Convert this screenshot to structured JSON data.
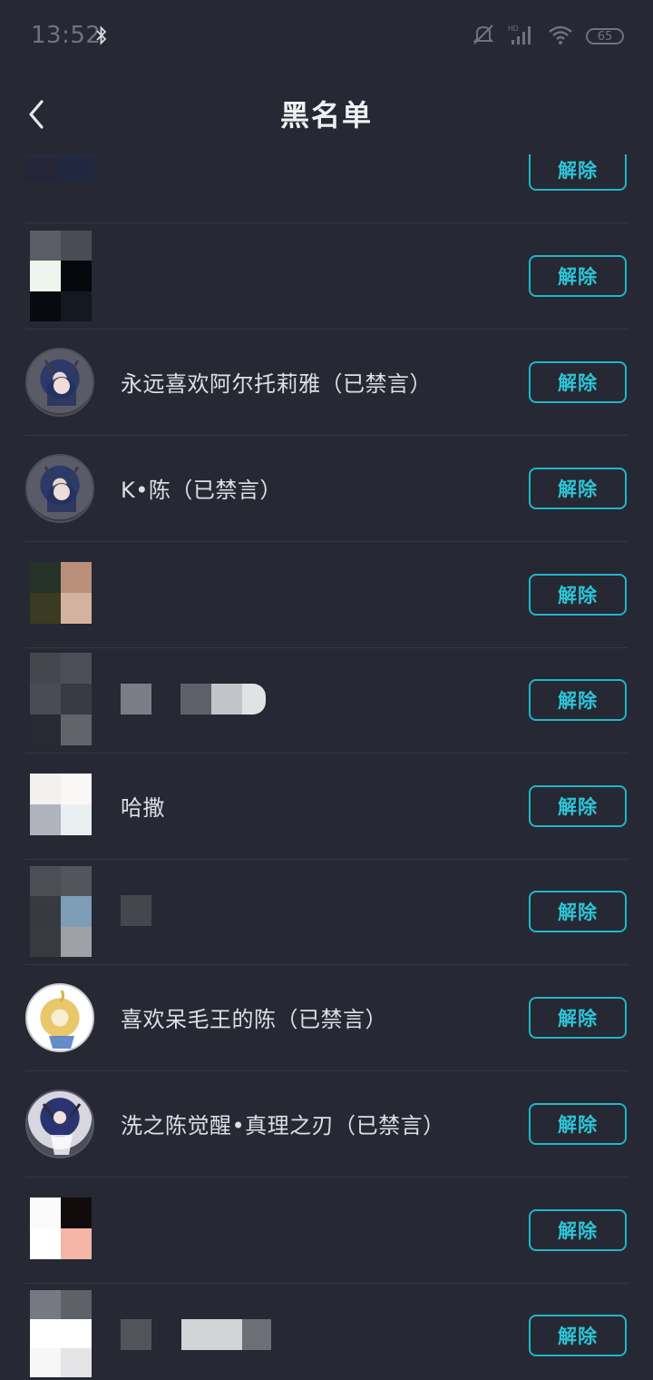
{
  "status_bar": {
    "time": "13:52",
    "battery": "65",
    "network": "HD"
  },
  "header": {
    "title": "黑名单"
  },
  "unblock_label": "解除",
  "rows": [
    {
      "name": ""
    },
    {
      "name": ""
    },
    {
      "name": "永远喜欢阿尔托莉雅（已禁言）"
    },
    {
      "name": "K•陈（已禁言）"
    },
    {
      "name": ""
    },
    {
      "name": ""
    },
    {
      "name": "哈撒"
    },
    {
      "name": ""
    },
    {
      "name": "喜欢呆毛王的陈（已禁言）"
    },
    {
      "name": "洗之陈觉醒•真理之刃（已禁言）"
    },
    {
      "name": ""
    },
    {
      "name": ""
    }
  ],
  "colors": {
    "accent": "#1fb6c9",
    "background": "#262833"
  }
}
